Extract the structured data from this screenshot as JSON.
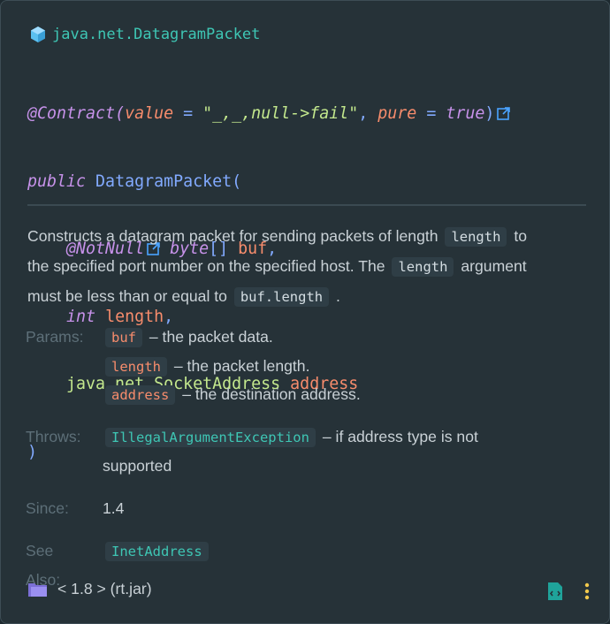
{
  "header": {
    "title": "java.net.DatagramPacket",
    "icon": "class-cube-icon",
    "color": "#3ec6b4"
  },
  "signature": {
    "annotation_at": "@",
    "annotation": "Contract",
    "open_paren": "(",
    "value_key": "value",
    "eq1": " = ",
    "value_str": "\"_,_,null->fail\"",
    "comma1": ", ",
    "pure_key": "pure",
    "eq2": " = ",
    "pure_val": "true",
    "close_paren": ")",
    "line2_kw": "public",
    "line2_name": " DatagramPacket(",
    "p1_ann": "@NotNull",
    "p1_type": " byte",
    "p1_brackets": "[]",
    "p1_name": " buf",
    "p1_comma": ",",
    "p2_type": "int",
    "p2_name": " length",
    "p2_comma": ",",
    "p3_type": "java.net.SocketAddress",
    "p3_name": " address",
    "end": ")"
  },
  "description": {
    "t1": "Constructs a datagram packet for sending packets of length ",
    "c1": "length",
    "t2": " to",
    "t3": "the specified port number on the specified host. The ",
    "c2": "length",
    "t4": " argument",
    "t5": "must be less than or equal to ",
    "c3": "buf.length",
    "t6": " ."
  },
  "params": {
    "label": "Params:",
    "items": [
      {
        "name": "buf",
        "desc": " – the packet data."
      },
      {
        "name": "length",
        "desc": " – the packet length."
      },
      {
        "name": "address",
        "desc": " – the destination address."
      }
    ]
  },
  "throws": {
    "label": "Throws:",
    "exception": "IllegalArgumentException",
    "desc1": " – if address type is not",
    "desc2": "supported"
  },
  "since": {
    "label": "Since:",
    "value": "1.4"
  },
  "see_also": {
    "label": "See Also:",
    "value": "InetAddress"
  },
  "footer": {
    "library": "< 1.8 > (rt.jar)",
    "folder_icon": "library-folder-icon",
    "source_icon": "view-source-icon",
    "menu_icon": "more-vertical-icon"
  }
}
